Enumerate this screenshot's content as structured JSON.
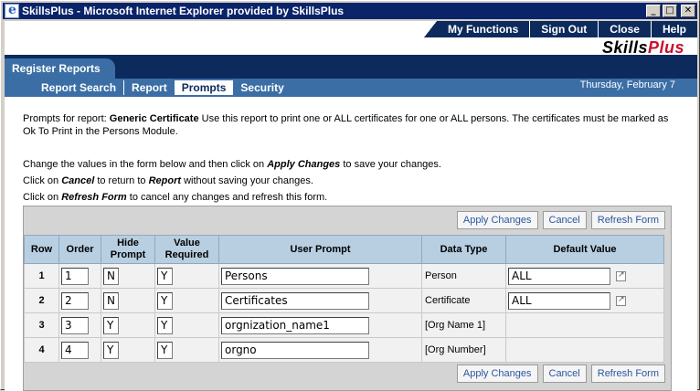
{
  "window": {
    "title": "SkillsPlus - Microsoft Internet Explorer provided by SkillsPlus",
    "controls": {
      "minimize": "_",
      "maximize": "□",
      "close": "✕"
    }
  },
  "topnav": {
    "items": [
      "My Functions",
      "Sign Out",
      "Close",
      "Help"
    ]
  },
  "logo": {
    "part1": "Skills",
    "part2": "Plus",
    "color2": "#c8102e"
  },
  "module": {
    "label": "Register Reports"
  },
  "subtabs": [
    {
      "label": "Report Search"
    },
    {
      "label": "Report"
    },
    {
      "label": "Prompts",
      "active": true
    },
    {
      "label": "Security"
    }
  ],
  "date": "Thursday, February 7",
  "description": {
    "prefix": "Prompts for report: ",
    "report_name": "Generic Certificate",
    "text": "  Use this report to print one or ALL certificates for one or ALL persons. The certificates must be marked as Ok To Print in the Persons Module."
  },
  "instructions": [
    {
      "pre": "Change the values in the form below and then click on ",
      "key": "Apply Changes",
      "post": " to save your changes."
    },
    {
      "pre": "Click on ",
      "key": "Cancel",
      "mid": " to return to ",
      "key2": "Report",
      "post": " without saving your changes."
    },
    {
      "pre": "Click on ",
      "key": "Refresh Form",
      "post": " to cancel any changes and refresh this form."
    }
  ],
  "buttons": {
    "apply": "Apply Changes",
    "cancel": "Cancel",
    "refresh": "Refresh Form"
  },
  "table": {
    "headers": {
      "row": "Row",
      "order": "Order",
      "hide_prompt_1": "Hide",
      "hide_prompt_2": "Prompt",
      "value_required_1": "Value",
      "value_required_2": "Required",
      "user_prompt": "User Prompt",
      "data_type": "Data Type",
      "default_value": "Default Value"
    },
    "rows": [
      {
        "row": "1",
        "order": "1",
        "hide": "N",
        "required": "Y",
        "prompt": "Persons",
        "type": "Person",
        "default": "ALL"
      },
      {
        "row": "2",
        "order": "2",
        "hide": "N",
        "required": "Y",
        "prompt": "Certificates",
        "type": "Certificate",
        "default": "ALL"
      },
      {
        "row": "3",
        "order": "3",
        "hide": "Y",
        "required": "Y",
        "prompt": "orgnization_name1",
        "type": "[Org Name 1]"
      },
      {
        "row": "4",
        "order": "4",
        "hide": "Y",
        "required": "Y",
        "prompt": "orgno",
        "type": "[Org Number]"
      }
    ]
  },
  "colors": {
    "nav_dark": "#0d2a5c",
    "nav_mid": "#3b6ea5",
    "header_cell": "#b7cfe1",
    "button_text": "#2a56a0"
  }
}
